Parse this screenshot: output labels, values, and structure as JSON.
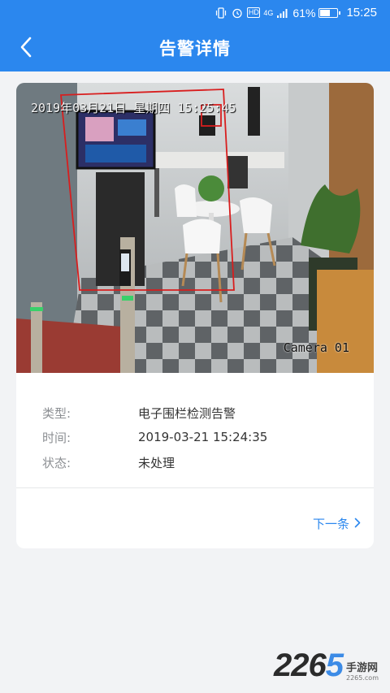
{
  "status_bar": {
    "network": "4G",
    "battery": "61%",
    "battery_level": 0.61,
    "time": "15:25",
    "icons": [
      "vibrate-icon",
      "alarm-icon",
      "hd-icon",
      "signal-icon",
      "battery-icon"
    ]
  },
  "header": {
    "title": "告警详情",
    "back_icon": "chevron-left-icon"
  },
  "camera": {
    "timestamp": "2019年03月21日 星期四 15:25:45",
    "label": "Camera 01"
  },
  "details": [
    {
      "label": "类型:",
      "value": "电子围栏检测告警"
    },
    {
      "label": "时间:",
      "value": "2019-03-21 15:24:35"
    },
    {
      "label": "状态:",
      "value": "未处理"
    }
  ],
  "footer": {
    "next_label": "下一条",
    "next_icon": "chevron-right-icon"
  },
  "watermark": {
    "number": "2265",
    "text": "手游网",
    "sub": "2265.com"
  },
  "colors": {
    "primary": "#2b87ee",
    "alert_box": "#d81e1e"
  }
}
